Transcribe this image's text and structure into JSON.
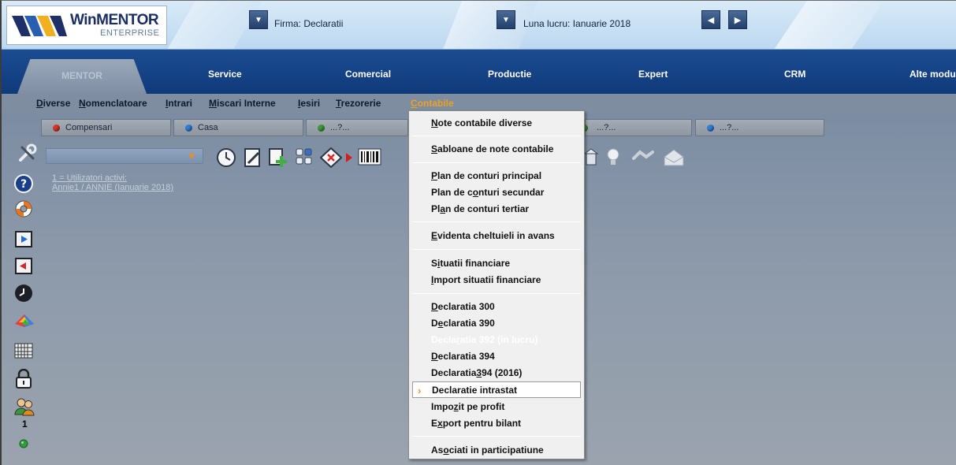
{
  "topbar": {
    "logo_win": "WinMENTOR",
    "logo_enterprise": "ENTERPRISE",
    "firma_label": "Firma:",
    "firma_value": "Declaratii",
    "luna_label": "Luna lucru:",
    "luna_value": "Ianuarie 2018"
  },
  "modules": {
    "mentor": "MENTOR",
    "service": "Service",
    "comercial": "Comercial",
    "productie": "Productie",
    "expert": "Expert",
    "crm": "CRM",
    "alte": "Alte modu"
  },
  "menu": {
    "diverse_a": "D",
    "diverse_b": "iverse",
    "nomenclatoare_a": "N",
    "nomenclatoare_b": "omenclatoare",
    "intrari_a": "I",
    "intrari_b": "ntrari",
    "miscari_a": "M",
    "miscari_b": "iscari Interne",
    "iesiri_a": "I",
    "iesiri_b": "esiri",
    "trezorerie_a": "T",
    "trezorerie_b": "rezorerie",
    "contabile_a": "C",
    "contabile_b": "ontabile"
  },
  "shortcuts": [
    {
      "label": "Compensari",
      "color": "#d9352b"
    },
    {
      "label": "Casa",
      "color": "#2f7fd9"
    },
    {
      "label": "...?...",
      "color": "#3a9a3a"
    },
    {
      "label": "...?...",
      "color": "#3a9a3a"
    },
    {
      "label": "...?...",
      "color": "#2f7fd9"
    }
  ],
  "users": {
    "line1": "1 = Utilizatori activi:",
    "line2": "Annie1   / ANNIE  (Ianuarie 2018)"
  },
  "sidebar": {
    "count": "1"
  },
  "dropdown": {
    "items": [
      {
        "a": "N",
        "b": "ote contabile diverse"
      },
      {
        "a": "S",
        "b": "abloane de note contabile"
      },
      {
        "a": "P",
        "b": "lan de conturi principal"
      },
      {
        "pre": "Plan de c",
        "a": "o",
        "b": "nturi secundar"
      },
      {
        "pre": "Pl",
        "a": "a",
        "b": "n de conturi tertiar"
      },
      {
        "a": "E",
        "b": "videnta cheltuieli in avans"
      },
      {
        "pre": "S",
        "a": "i",
        "b": "tuatii financiare"
      },
      {
        "a": "I",
        "b": "mport situatii financiare"
      },
      {
        "a": "D",
        "b": "eclaratia 300"
      },
      {
        "pre": "D",
        "a": "e",
        "b": "claratia 390"
      },
      {
        "pre": "Decla",
        "a": "r",
        "b": "atia 392 (in lucru)"
      },
      {
        "a": "D",
        "b": "eclaratia 394"
      },
      {
        "pre": "Declaratia ",
        "a": "3",
        "b": "94 (2016)"
      },
      {
        "pre": "",
        "a": "",
        "b": "Declaratie intrastat"
      },
      {
        "pre": "Impo",
        "a": "z",
        "b": "it pe profit"
      },
      {
        "pre": "E",
        "a": "x",
        "b": "port pentru bilant"
      },
      {
        "pre": "As",
        "a": "o",
        "b": "ciati in participatiune"
      }
    ]
  }
}
